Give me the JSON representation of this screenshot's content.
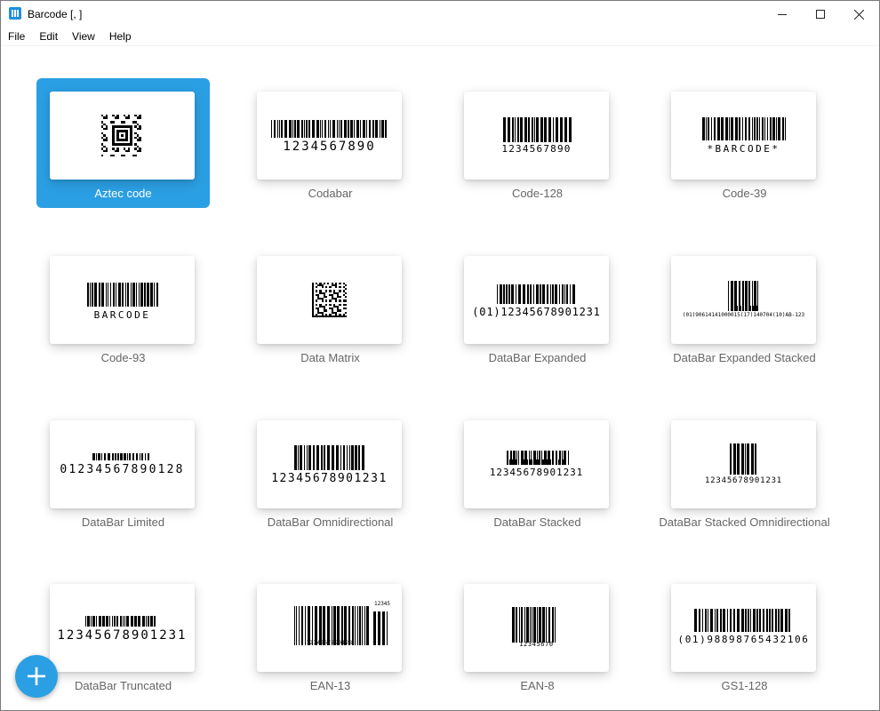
{
  "window": {
    "title": "Barcode [, ]"
  },
  "menu": [
    "File",
    "Edit",
    "View",
    "Help"
  ],
  "colors": {
    "accent": "#2b9fe3",
    "label": "#666666"
  },
  "tiles": [
    {
      "label": "Aztec code",
      "kind": "aztec",
      "text": "",
      "selected": true
    },
    {
      "label": "Codabar",
      "kind": "linear",
      "text": "1234567890"
    },
    {
      "label": "Code-128",
      "kind": "linear",
      "text": "1234567890"
    },
    {
      "label": "Code-39",
      "kind": "linear",
      "text": "*BARCODE*"
    },
    {
      "label": "Code-93",
      "kind": "linear",
      "text": "BARCODE"
    },
    {
      "label": "Data Matrix",
      "kind": "matrix",
      "text": ""
    },
    {
      "label": "DataBar Expanded",
      "kind": "linear",
      "text": "(01)12345678901231"
    },
    {
      "label": "DataBar Expanded Stacked",
      "kind": "stacked",
      "text": "(01)90614141000015(17)140704(10)AB-123"
    },
    {
      "label": "DataBar Limited",
      "kind": "linear",
      "text": "01234567890128"
    },
    {
      "label": "DataBar Omnidirectional",
      "kind": "linear",
      "text": "12345678901231"
    },
    {
      "label": "DataBar Stacked",
      "kind": "stacked",
      "text": "12345678901231"
    },
    {
      "label": "DataBar Stacked Omnidirectional",
      "kind": "linear",
      "text": "12345678901231"
    },
    {
      "label": "DataBar Truncated",
      "kind": "linear",
      "text": "12345678901231"
    },
    {
      "label": "EAN-13",
      "kind": "ean",
      "text": "1234567890128",
      "addon": "12345"
    },
    {
      "label": "EAN-8",
      "kind": "ean",
      "text": "12345670"
    },
    {
      "label": "GS1-128",
      "kind": "linear",
      "text": "(01)98898765432106"
    }
  ],
  "fab": {
    "symbol": "+",
    "icon": "plus-icon"
  }
}
